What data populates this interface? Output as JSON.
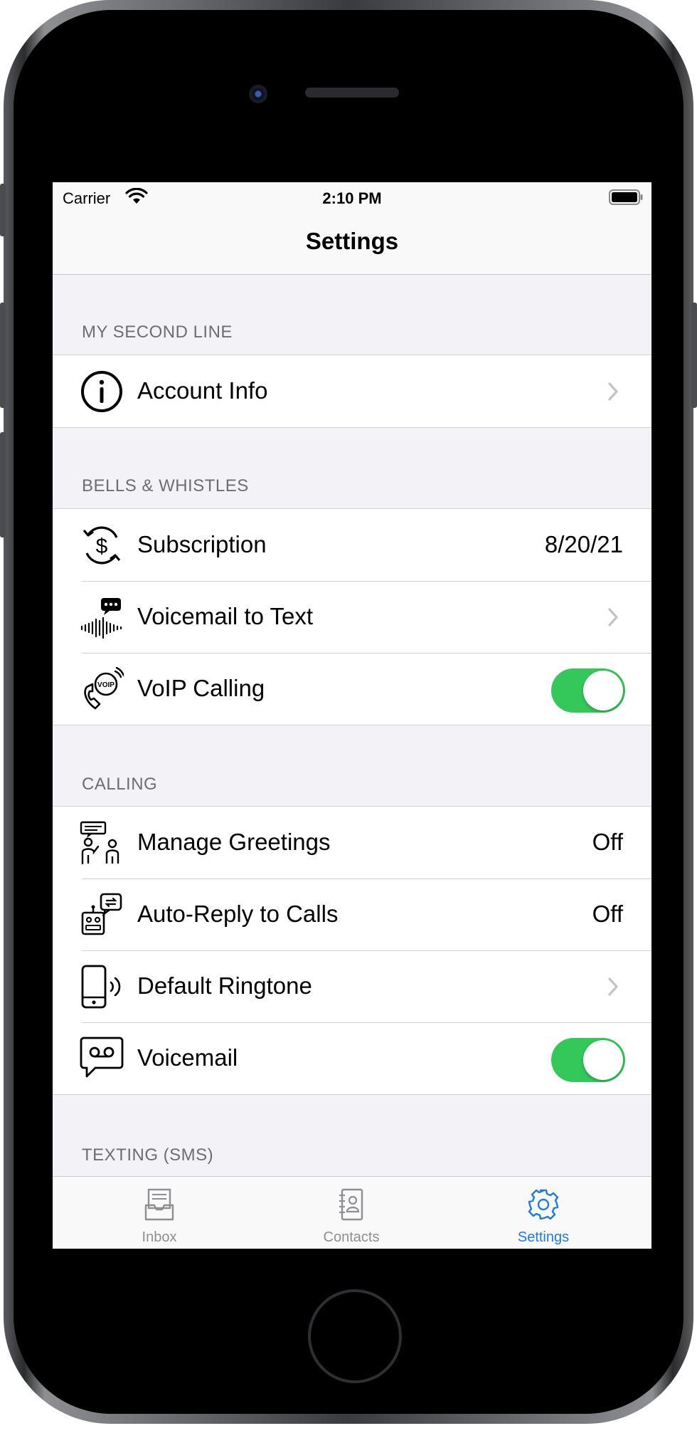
{
  "status_bar": {
    "carrier": "Carrier",
    "time": "2:10 PM"
  },
  "nav": {
    "title": "Settings"
  },
  "sections": {
    "my_second_line": {
      "header": "MY SECOND LINE",
      "rows": {
        "account_info": {
          "label": "Account Info",
          "icon": "info-icon"
        }
      }
    },
    "bells": {
      "header": "BELLS & WHISTLES",
      "rows": {
        "subscription": {
          "label": "Subscription",
          "value": "8/20/21",
          "icon": "dollar-cycle-icon"
        },
        "voicemail_to_text": {
          "label": "Voicemail to Text",
          "icon": "voicemail-transcript-icon"
        },
        "voip_calling": {
          "label": "VoIP Calling",
          "toggle_on": true,
          "icon": "voip-phone-icon"
        }
      }
    },
    "calling": {
      "header": "CALLING",
      "rows": {
        "manage_greetings": {
          "label": "Manage Greetings",
          "value": "Off",
          "icon": "greeting-people-icon"
        },
        "auto_reply": {
          "label": "Auto-Reply to Calls",
          "value": "Off",
          "icon": "robot-reply-icon"
        },
        "default_ringtone": {
          "label": "Default Ringtone",
          "icon": "ringing-phone-icon"
        },
        "voicemail": {
          "label": "Voicemail",
          "toggle_on": true,
          "icon": "voicemail-bubble-icon"
        }
      }
    },
    "texting": {
      "header": "TEXTING (SMS)"
    }
  },
  "tab_bar": {
    "inbox": {
      "label": "Inbox",
      "icon": "inbox-icon"
    },
    "contacts": {
      "label": "Contacts",
      "icon": "contacts-book-icon"
    },
    "settings": {
      "label": "Settings",
      "icon": "gear-icon",
      "active": true
    }
  },
  "colors": {
    "accent": "#1c7ce0",
    "toggle_on": "#34c759",
    "grouped_bg": "#f2f2f7"
  }
}
